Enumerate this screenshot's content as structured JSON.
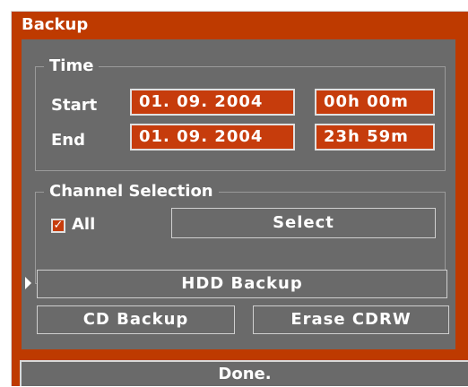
{
  "window": {
    "title": "Backup"
  },
  "time": {
    "legend": "Time",
    "start_label": "Start",
    "end_label": "End",
    "start_date": "01. 09. 2004",
    "start_time": "00h 00m",
    "end_date": "01. 09. 2004",
    "end_time": "23h 59m"
  },
  "channel": {
    "legend": "Channel Selection",
    "all_label": "All",
    "all_checked": true,
    "checkmark": "✓",
    "select_label": "Select"
  },
  "actions": {
    "hdd_backup": "HDD Backup",
    "cd_backup": "CD Backup",
    "erase_cdrw": "Erase CDRW",
    "selected_marker": "pointer-right-icon"
  },
  "status": {
    "done": "Done."
  },
  "colors": {
    "accent": "#be3a00",
    "field": "#c63c0c",
    "panel": "#6a6a6a",
    "border": "#d8d8d8"
  }
}
